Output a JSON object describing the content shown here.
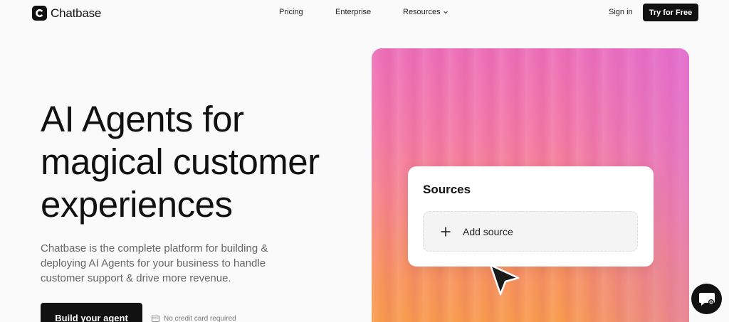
{
  "header": {
    "brand": "Chatbase",
    "nav": [
      "Pricing",
      "Enterprise",
      "Resources"
    ],
    "signin": "Sign in",
    "cta": "Try for Free"
  },
  "hero": {
    "title_lines": [
      "AI Agents for",
      "magical customer",
      "experiences"
    ],
    "subtitle": "Chatbase is the complete platform for building & deploying AI Agents for your business to handle customer support & drive more revenue.",
    "cta": "Build your agent",
    "note": "No credit card required"
  },
  "panel": {
    "card_title": "Sources",
    "add_label": "Add source"
  },
  "icons": {
    "logo": "chatbase-logo-icon",
    "chevron": "chevron-down-icon",
    "card": "credit-card-icon",
    "plus": "plus-icon",
    "cursor": "cursor-icon",
    "chat": "chat-bubble-icon"
  },
  "colors": {
    "primary": "#111111",
    "panel_top": "#ec6fb8",
    "panel_bottom": "#f89c48"
  }
}
